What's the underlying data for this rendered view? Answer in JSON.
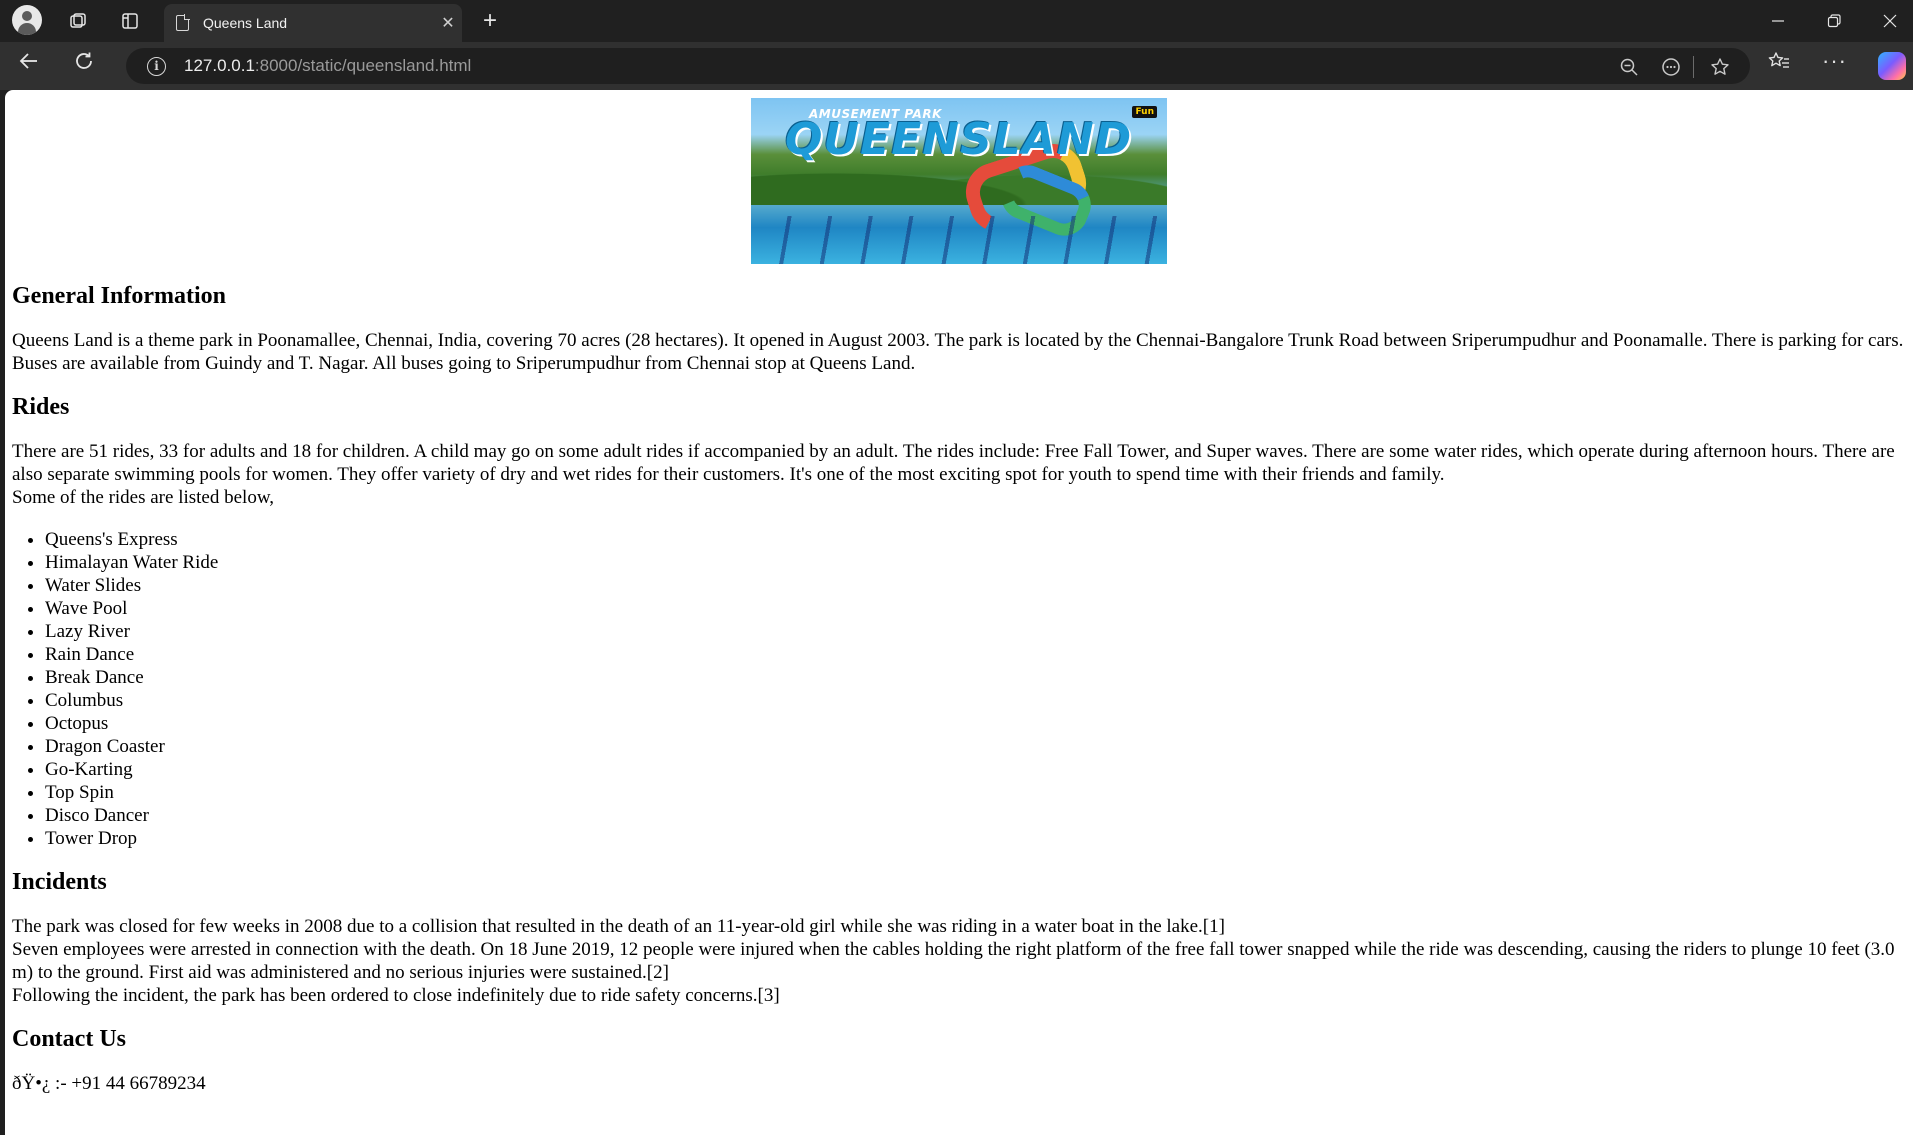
{
  "browser": {
    "tab_title": "Queens Land",
    "url_host": "127.0.0.1",
    "url_rest": ":8000/static/queensland.html",
    "icons": {
      "profile": "profile-icon",
      "workspaces": "workspaces-icon",
      "tab_actions": "tab-actions-icon",
      "page": "page-icon",
      "close_tab": "close-icon",
      "new_tab": "plus-icon",
      "back": "back-arrow-icon",
      "reload": "reload-icon",
      "site_info": "info-icon",
      "zoom": "zoom-out-icon",
      "reader": "more-circle-icon",
      "favorite": "star-icon",
      "favorites": "favorites-icon",
      "menu": "more-icon",
      "copilot": "copilot-icon"
    }
  },
  "banner": {
    "subtitle": "AMUSEMENT PARK",
    "title": "QUEENSLAND",
    "badge": "Fun"
  },
  "sections": {
    "general": {
      "heading": "General Information",
      "text": "Queens Land is a theme park in Poonamallee, Chennai, India, covering 70 acres (28 hectares). It opened in August 2003. The park is located by the Chennai-Bangalore Trunk Road between Sriperumpudhur and Poonamalle. There is parking for cars. Buses are available from Guindy and T. Nagar. All buses going to Sriperumpudhur from Chennai stop at Queens Land."
    },
    "rides": {
      "heading": "Rides",
      "text": "There are 51 rides, 33 for adults and 18 for children. A child may go on some adult rides if accompanied by an adult. The rides include: Free Fall Tower, and Super waves. There are some water rides, which operate during afternoon hours. There are also separate swimming pools for women. They offer variety of dry and wet rides for their customers. It's one of the most exciting spot for youth to spend time with their friends and family.",
      "list_intro": "Some of the rides are listed below,",
      "items": [
        "Queens's Express",
        "Himalayan Water Ride",
        "Water Slides",
        "Wave Pool",
        "Lazy River",
        "Rain Dance",
        "Break Dance",
        "Columbus",
        "Octopus",
        "Dragon Coaster",
        "Go-Karting",
        "Top Spin",
        "Disco Dancer",
        "Tower Drop"
      ]
    },
    "incidents": {
      "heading": "Incidents",
      "line1": "The park was closed for few weeks in 2008 due to a collision that resulted in the death of an 11-year-old girl while she was riding in a water boat in the lake.[1]",
      "line2": "Seven employees were arrested in connection with the death. On 18 June 2019, 12 people were injured when the cables holding the right platform of the free fall tower snapped while the ride was descending, causing the riders to plunge 10 feet (3.0 m) to the ground. First aid was administered and no serious injuries were sustained.[2]",
      "line3": "Following the incident, the park has been ordered to close indefinitely due to ride safety concerns.[3]"
    },
    "contact": {
      "heading": "Contact Us",
      "phone_line": "ðŸ•¿ :- +91 44 66789234"
    }
  }
}
